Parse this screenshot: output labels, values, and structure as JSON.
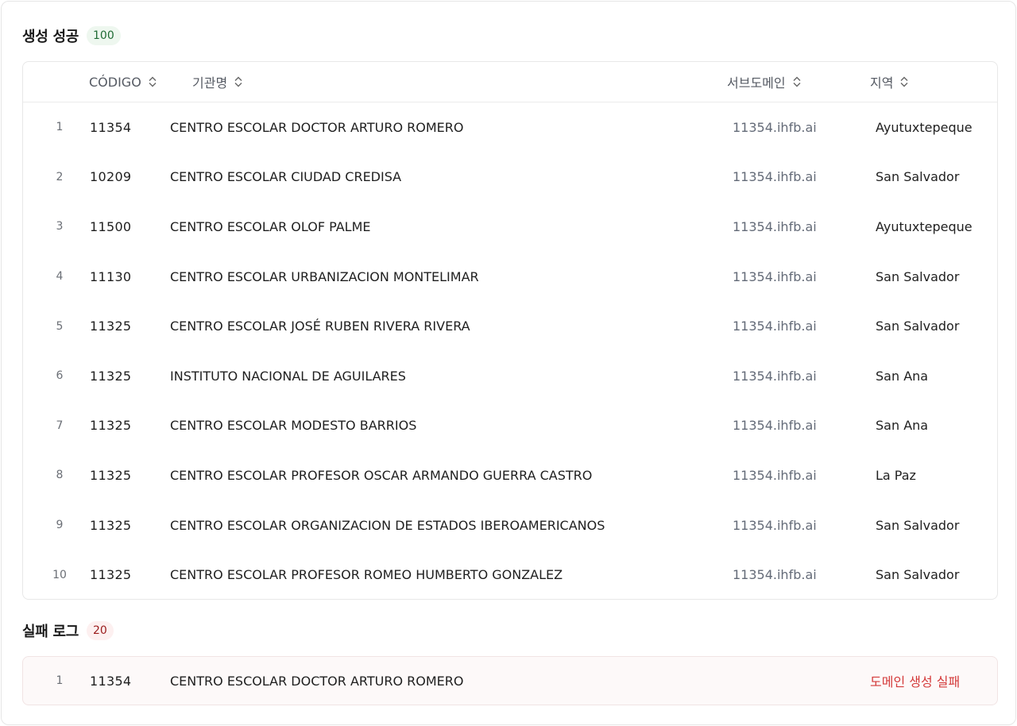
{
  "success": {
    "title": "생성 성공",
    "count": "100",
    "columns": {
      "code": "CÓDIGO",
      "name": "기관명",
      "subdomain": "서브도메인",
      "region": "지역"
    },
    "rows": [
      {
        "idx": "1",
        "code": "11354",
        "name": "CENTRO ESCOLAR DOCTOR ARTURO ROMERO",
        "subdomain": "11354.ihfb.ai",
        "region": "Ayutuxtepeque"
      },
      {
        "idx": "2",
        "code": "10209",
        "name": "CENTRO ESCOLAR CIUDAD CREDISA",
        "subdomain": "11354.ihfb.ai",
        "region": "San Salvador"
      },
      {
        "idx": "3",
        "code": "11500",
        "name": "CENTRO ESCOLAR OLOF PALME",
        "subdomain": "11354.ihfb.ai",
        "region": "Ayutuxtepeque"
      },
      {
        "idx": "4",
        "code": "11130",
        "name": "CENTRO ESCOLAR URBANIZACION MONTELIMAR",
        "subdomain": "11354.ihfb.ai",
        "region": "San Salvador"
      },
      {
        "idx": "5",
        "code": "11325",
        "name": "CENTRO ESCOLAR JOSÉ RUBEN RIVERA RIVERA",
        "subdomain": "11354.ihfb.ai",
        "region": "San Salvador"
      },
      {
        "idx": "6",
        "code": "11325",
        "name": "INSTITUTO NACIONAL DE AGUILARES",
        "subdomain": "11354.ihfb.ai",
        "region": "San Ana"
      },
      {
        "idx": "7",
        "code": "11325",
        "name": "CENTRO ESCOLAR MODESTO BARRIOS",
        "subdomain": "11354.ihfb.ai",
        "region": "San Ana"
      },
      {
        "idx": "8",
        "code": "11325",
        "name": "CENTRO ESCOLAR PROFESOR OSCAR ARMANDO GUERRA CASTRO",
        "subdomain": "11354.ihfb.ai",
        "region": "La Paz"
      },
      {
        "idx": "9",
        "code": "11325",
        "name": "CENTRO ESCOLAR ORGANIZACION DE ESTADOS IBEROAMERICANOS",
        "subdomain": "11354.ihfb.ai",
        "region": "San Salvador"
      },
      {
        "idx": "10",
        "code": "11325",
        "name": "CENTRO ESCOLAR PROFESOR ROMEO HUMBERTO GONZALEZ",
        "subdomain": "11354.ihfb.ai",
        "region": "San Salvador"
      }
    ]
  },
  "failure": {
    "title": "실패 로그",
    "count": "20",
    "rows": [
      {
        "idx": "1",
        "code": "11354",
        "name": "CENTRO ESCOLAR DOCTOR ARTURO ROMERO",
        "error": "도메인 생성 실패"
      }
    ]
  },
  "icons": {
    "sort": "sort-icon"
  },
  "colors": {
    "success_badge_bg": "#eef7ef",
    "success_badge_text": "#1f6b34",
    "failure_badge_bg": "#fdf0f0",
    "failure_badge_text": "#9b1c1c",
    "error_text": "#d43a3a"
  }
}
